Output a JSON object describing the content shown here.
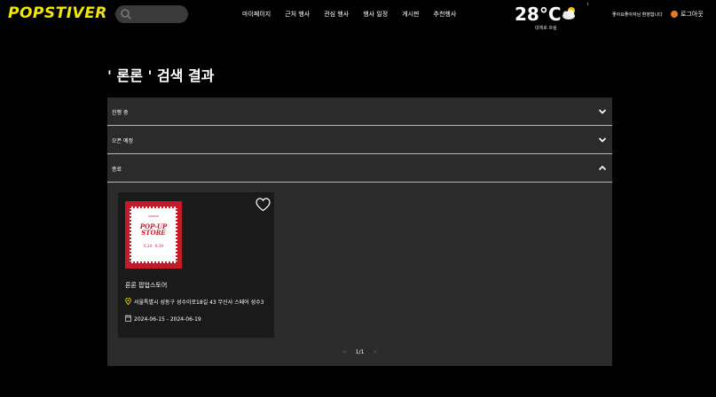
{
  "header": {
    "logo": "POPSTIVER",
    "search": {
      "placeholder": ""
    },
    "nav": [
      "마이페이지",
      "근처 행사",
      "관심 행사",
      "행사 일정",
      "게시판",
      "추천행사"
    ],
    "weather": {
      "temperature": "28°C",
      "description": "대체로 흐림",
      "icon": "partly-cloudy-icon"
    },
    "greeting": "좋아요좋아자님 환영합니다",
    "logout": "로그아웃"
  },
  "page": {
    "title": "' 론론 ' 검색 결과"
  },
  "accordion": {
    "sections": [
      {
        "label": "진행 중",
        "expanded": false
      },
      {
        "label": "오픈 예정",
        "expanded": false
      },
      {
        "label": "종료",
        "expanded": true
      }
    ]
  },
  "results": [
    {
      "poster": {
        "top_text": "RONRON",
        "title": "POP-UP STORE",
        "dates": "6.14 - 6.19"
      },
      "name": "론론 팝업스토어",
      "address": "서울특별시 성동구 성수이로18길 43 무신사 스페어 성수3",
      "date_range": "2024-06-15 - 2024-06-19",
      "liked": false
    }
  ],
  "pagination": {
    "prev": "<",
    "current": "1/1",
    "next": ">"
  },
  "colors": {
    "accent": "#f3e600",
    "panel": "#2b2b2b",
    "divider": "#d8c800",
    "background": "#000000"
  }
}
